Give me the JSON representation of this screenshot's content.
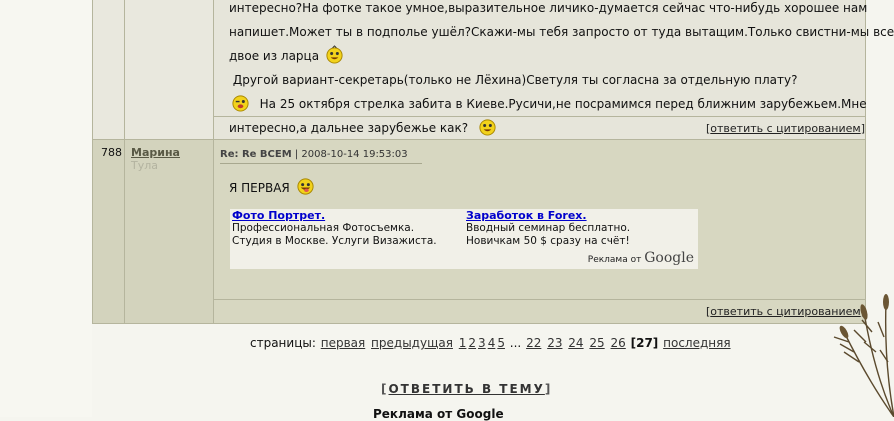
{
  "prev_post": {
    "lines": [
      "интересно?На фотке такое умное,выразительное личико-думается сейчас что-нибудь хорошее нам",
      "напишет.Может ты в подполье ушёл?Скажи-мы тебя запросто от туда вытащим.Только свистни-мы все как",
      "двое из ларца",
      "Другой вариант-секретарь(только не Лёхина)Светуля ты согласна за отдельную плату?",
      "На 25 октября стрелка забита в Киеве.Русичи,не посрамимся перед ближним зарубежьем.Мне",
      "интересно,а дальнее зарубежье как?"
    ],
    "quote_link": "ответить с цитированием"
  },
  "post": {
    "number": "788",
    "author": "Марина",
    "city": "Тула",
    "subject": "Re: Re ВСЕМ",
    "separator": "|",
    "date": "2008-10-14 19:53:03",
    "text": "Я ПЕРВАЯ",
    "quote_link": "ответить с цитированием"
  },
  "ads": [
    {
      "title": "Фото Портрет.",
      "text": "Профессиональная Фотосъемка. Студия в Москве. Услуги Визажиста."
    },
    {
      "title": "Заработок в Forex.",
      "text": "Вводный семинар бесплатно. Новичкам 50 $ сразу на счёт!"
    }
  ],
  "ad_credit": {
    "prefix": "Реклама от",
    "brand": "Google"
  },
  "pagination": {
    "label": "страницы:",
    "first": "первая",
    "prev": "предыдущая",
    "pages": [
      "1",
      "2",
      "3",
      "4",
      "5"
    ],
    "ellipsis": "...",
    "pages_end": [
      "22",
      "23",
      "24",
      "25",
      "26"
    ],
    "current": "[27]",
    "last": "последняя"
  },
  "reply": {
    "open": "[",
    "label": "ОТВЕТИТЬ В ТЕМУ",
    "close": "]"
  },
  "bottom_ads_label": "Реклама от Google"
}
